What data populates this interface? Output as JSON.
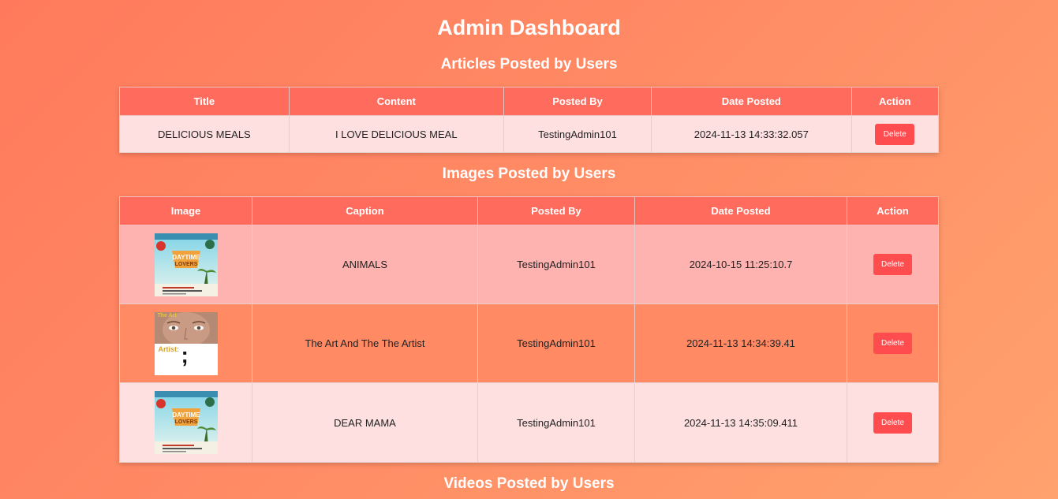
{
  "page_title": "Admin Dashboard",
  "articles": {
    "heading": "Articles Posted by Users",
    "columns": [
      "Title",
      "Content",
      "Posted By",
      "Date Posted",
      "Action"
    ],
    "rows": [
      {
        "title": "DELICIOUS MEALS",
        "content": "I LOVE DELICIOUS MEAL",
        "posted_by": "TestingAdmin101",
        "date": "2024-11-13 14:33:32.057",
        "action": "Delete"
      }
    ]
  },
  "images": {
    "heading": "Images Posted by Users",
    "columns": [
      "Image",
      "Caption",
      "Posted By",
      "Date Posted",
      "Action"
    ],
    "rows": [
      {
        "image_icon": "event-flyer-thumbnail",
        "poster_text": "DAYTIME LOVERS",
        "caption": "ANIMALS",
        "posted_by": "TestingAdmin101",
        "date": "2024-10-15 11:25:10.7",
        "action": "Delete"
      },
      {
        "image_icon": "artist-portrait-thumbnail",
        "portrait_top_text": "The Art",
        "portrait_label": "Artist:",
        "portrait_mark": ";",
        "caption": "The Art And The The Artist",
        "posted_by": "TestingAdmin101",
        "date": "2024-11-13 14:34:39.41",
        "action": "Delete"
      },
      {
        "image_icon": "event-flyer-thumbnail",
        "poster_text": "DAYTIME LOVERS",
        "caption": "DEAR MAMA",
        "posted_by": "TestingAdmin101",
        "date": "2024-11-13 14:35:09.411",
        "action": "Delete"
      }
    ]
  },
  "videos": {
    "heading": "Videos Posted by Users"
  },
  "colors": {
    "background_start": "#ff7a5c",
    "background_end": "#ffa26e",
    "table_header": "#ff6b5c",
    "delete_button": "#ff4d4f"
  }
}
